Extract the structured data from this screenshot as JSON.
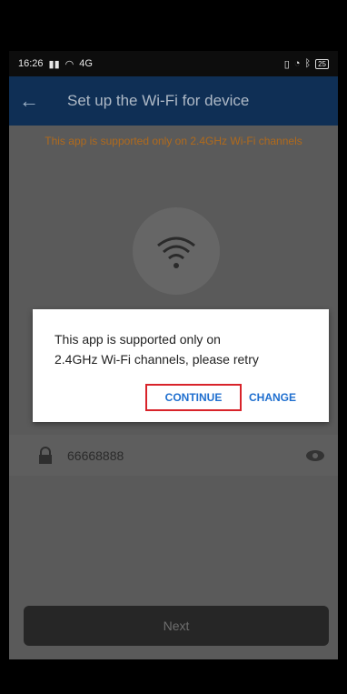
{
  "status_bar": {
    "time": "16:26",
    "signal": "4G",
    "battery": "25"
  },
  "app_bar": {
    "title": "Set up the Wi-Fi for device"
  },
  "warning": "This app is supported only on 2.4GHz Wi-Fi channels",
  "password": {
    "value": "66668888"
  },
  "next_button": "Next",
  "dialog": {
    "line1": "This app is supported only on",
    "line2": "2.4GHz Wi-Fi channels, please retry",
    "continue_label": "CONTINUE",
    "change_label": "CHANGE"
  },
  "colors": {
    "app_bar": "#0f2f55",
    "warning": "#b06a1c",
    "accent": "#1f6fcf",
    "highlight": "#d8232a"
  }
}
